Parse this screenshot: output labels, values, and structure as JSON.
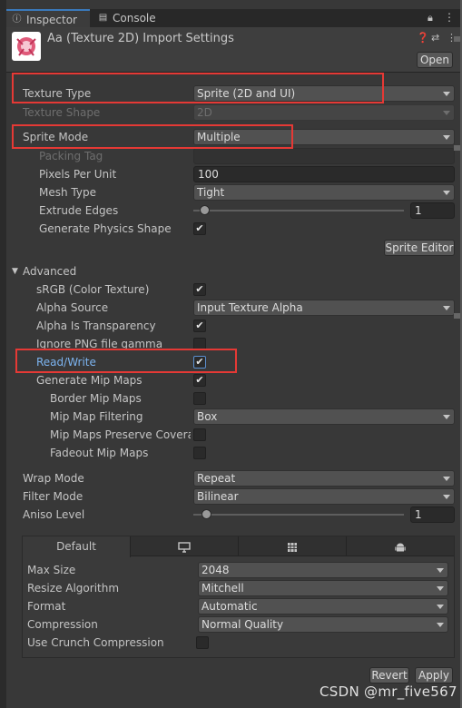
{
  "tabs": {
    "inspector": "Inspector",
    "console": "Console"
  },
  "header": {
    "title": "Aa (Texture 2D) Import Settings",
    "open_label": "Open"
  },
  "texture": {
    "texture_type": {
      "label": "Texture Type",
      "value": "Sprite (2D and UI)"
    },
    "texture_shape": {
      "label": "Texture Shape",
      "value": "2D"
    },
    "sprite_mode": {
      "label": "Sprite Mode",
      "value": "Multiple"
    },
    "packing_tag": {
      "label": "Packing Tag",
      "value": ""
    },
    "pixels_per_unit": {
      "label": "Pixels Per Unit",
      "value": "100"
    },
    "mesh_type": {
      "label": "Mesh Type",
      "value": "Tight"
    },
    "extrude_edges": {
      "label": "Extrude Edges",
      "value": "1",
      "level": 0.05
    },
    "generate_physics_shape": {
      "label": "Generate Physics Shape",
      "checked": true
    },
    "sprite_editor_label": "Sprite Editor"
  },
  "advanced": {
    "title": "Advanced",
    "srgb": {
      "label": "sRGB (Color Texture)",
      "checked": true
    },
    "alpha_source": {
      "label": "Alpha Source",
      "value": "Input Texture Alpha"
    },
    "alpha_is_transparency": {
      "label": "Alpha Is Transparency",
      "checked": true
    },
    "ignore_png_gamma": {
      "label": "Ignore PNG file gamma",
      "checked": false
    },
    "read_write": {
      "label": "Read/Write",
      "checked": true
    },
    "generate_mip_maps": {
      "label": "Generate Mip Maps",
      "checked": true
    },
    "border_mip_maps": {
      "label": "Border Mip Maps",
      "checked": false
    },
    "mip_map_filtering": {
      "label": "Mip Map Filtering",
      "value": "Box"
    },
    "mip_maps_preserve_coverage": {
      "label": "Mip Maps Preserve Coverag",
      "checked": false
    },
    "fadeout_mip_maps": {
      "label": "Fadeout Mip Maps",
      "checked": false
    }
  },
  "wrap_mode": {
    "label": "Wrap Mode",
    "value": "Repeat"
  },
  "filter_mode": {
    "label": "Filter Mode",
    "value": "Bilinear"
  },
  "aniso_level": {
    "label": "Aniso Level",
    "value": "1",
    "level": 0.06
  },
  "platform": {
    "tabs": [
      "Default",
      "monitor-icon",
      "grid-icon",
      "android-icon"
    ],
    "max_size": {
      "label": "Max Size",
      "value": "2048"
    },
    "resize_algorithm": {
      "label": "Resize Algorithm",
      "value": "Mitchell"
    },
    "format": {
      "label": "Format",
      "value": "Automatic"
    },
    "compression": {
      "label": "Compression",
      "value": "Normal Quality"
    },
    "use_crunch": {
      "label": "Use Crunch Compression",
      "checked": false
    }
  },
  "footer": {
    "revert_label": "Revert",
    "apply_label": "Apply"
  },
  "watermark": "CSDN @mr_five567",
  "colors": {
    "highlight_box": "#e53935",
    "accent_tab": "#3a79bb",
    "readwrite_label": "#7cb4f0"
  }
}
